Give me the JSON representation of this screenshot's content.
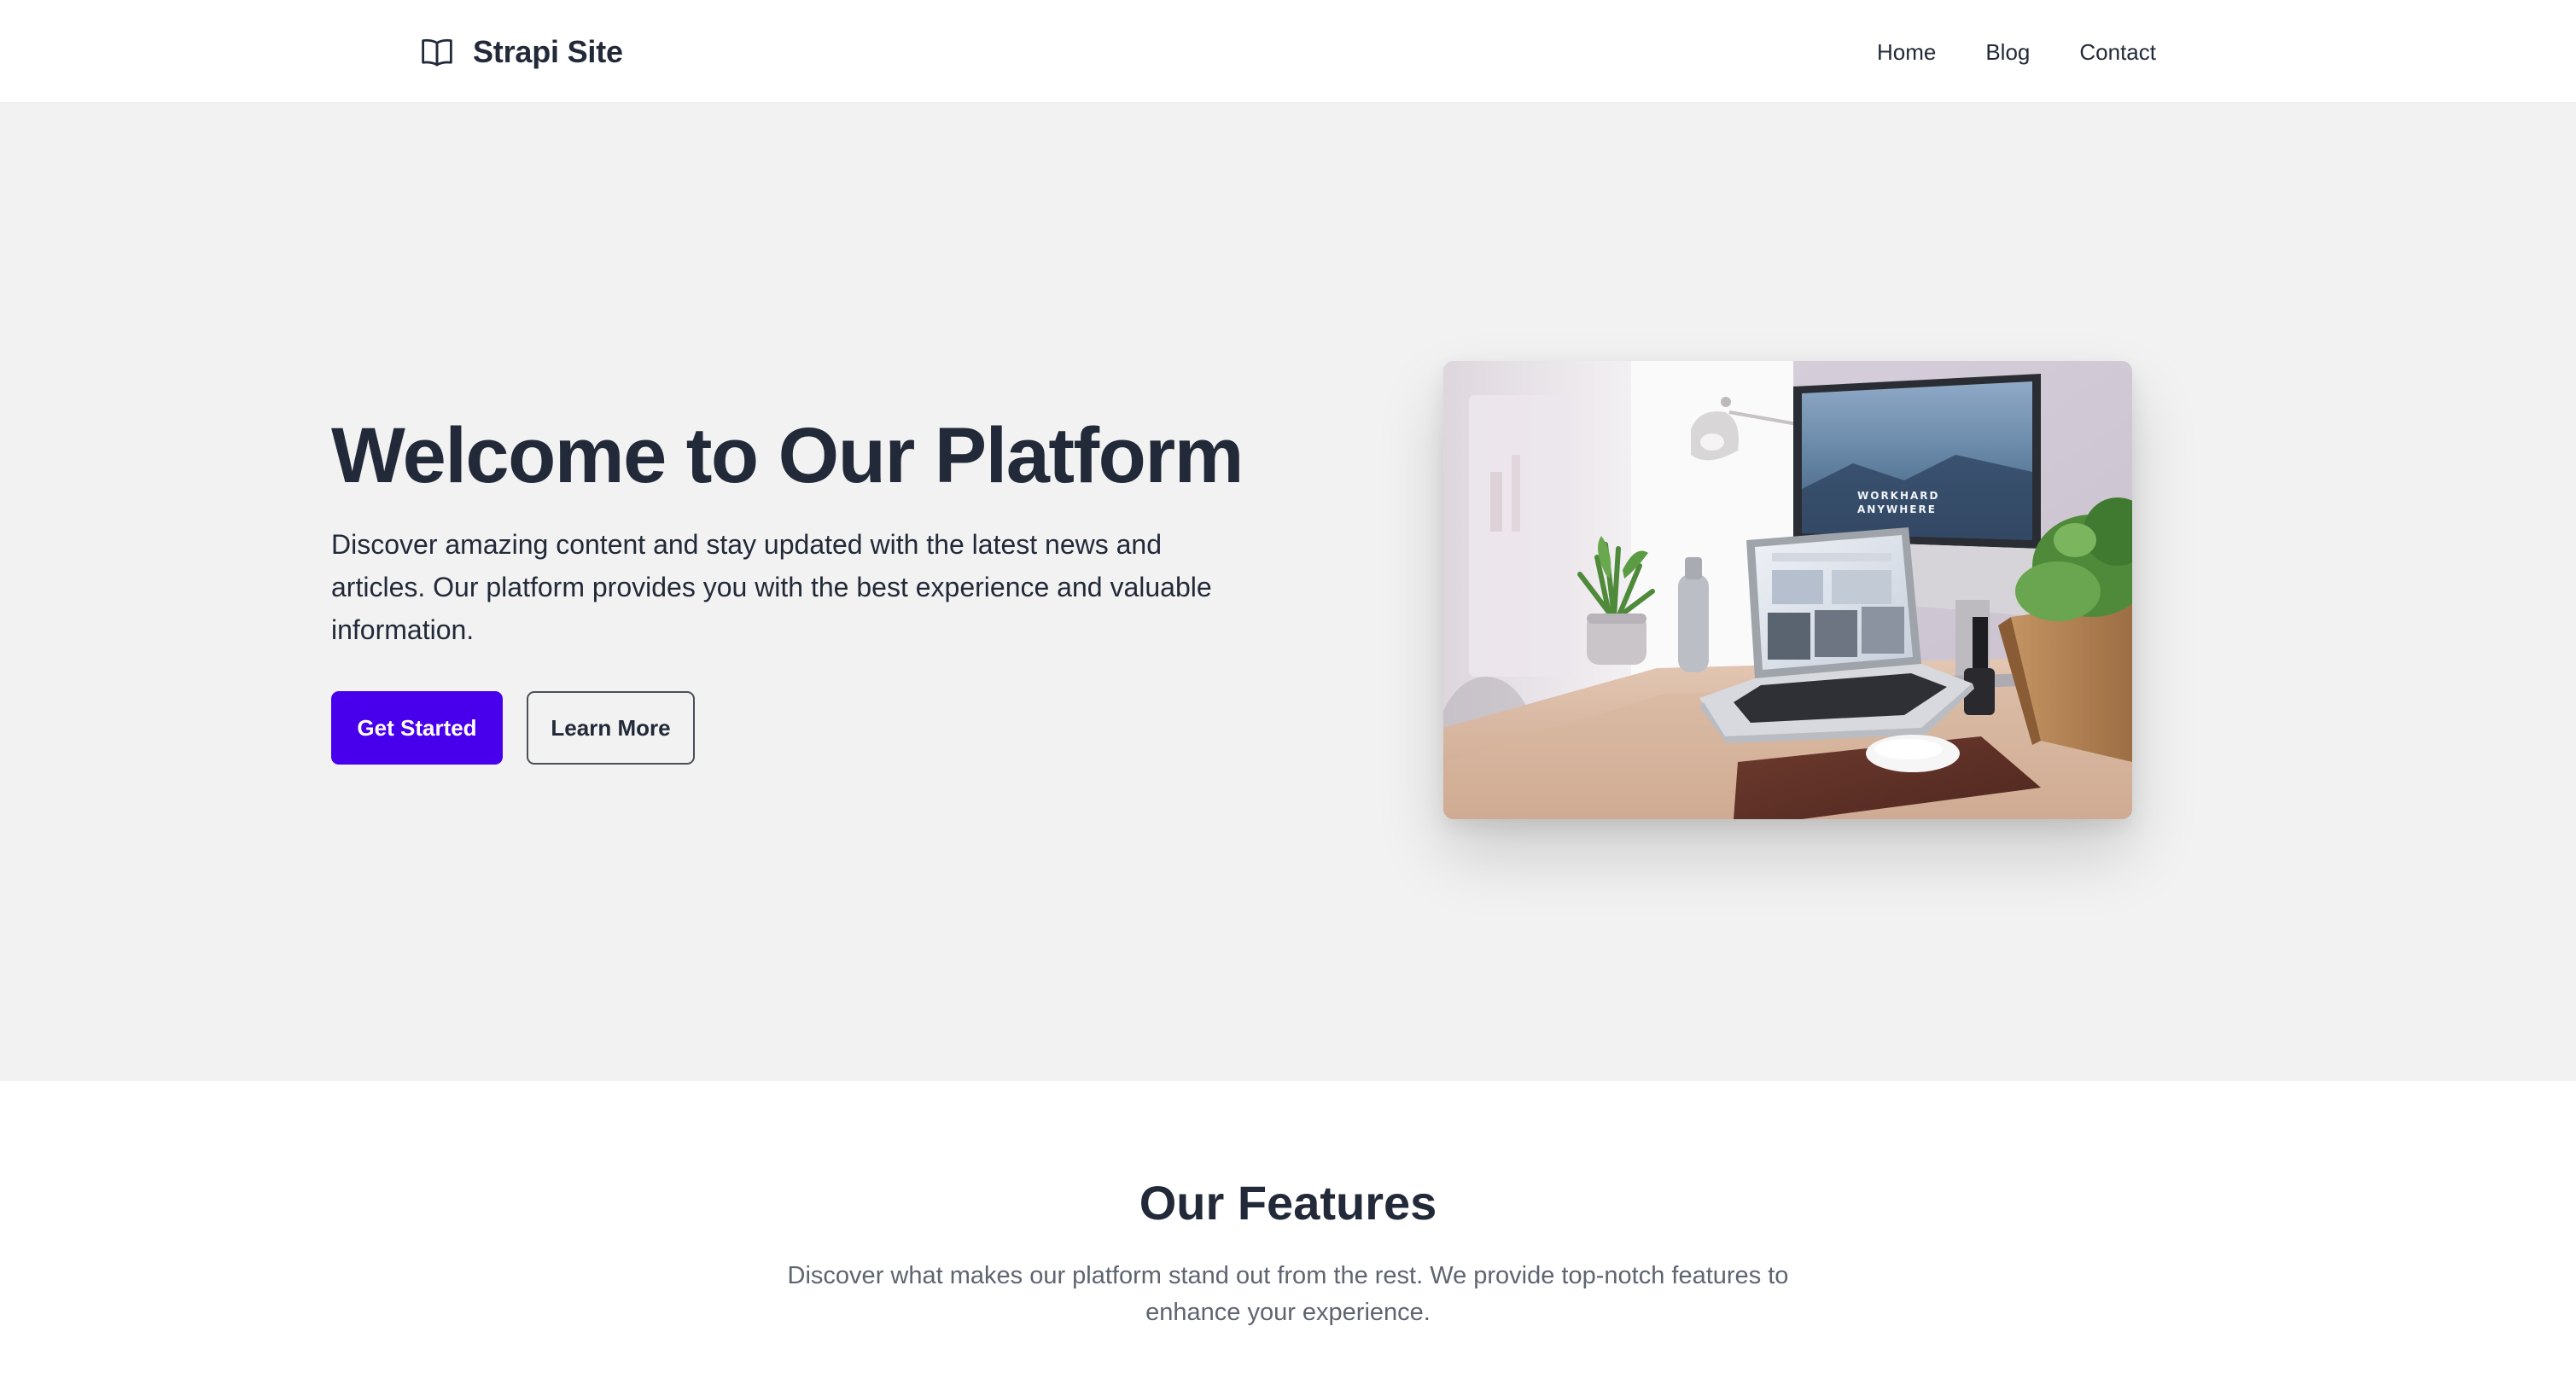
{
  "header": {
    "brand_icon": "book-open-icon",
    "brand_name": "Strapi Site",
    "nav": [
      {
        "label": "Home"
      },
      {
        "label": "Blog"
      },
      {
        "label": "Contact"
      }
    ]
  },
  "hero": {
    "title": "Welcome to Our Platform",
    "description": "Discover amazing content and stay updated with the latest news and articles. Our platform provides you with the best experience and valuable information.",
    "primary_button": "Get Started",
    "secondary_button": "Learn More",
    "image_text": [
      "WORKHARD",
      "ANYWHERE"
    ]
  },
  "features": {
    "title": "Our Features",
    "description": "Discover what makes our platform stand out from the rest. We provide top-notch features to enhance your experience."
  },
  "colors": {
    "primary": "#4800ec",
    "text": "#222938",
    "hero_bg": "#f2f2f2",
    "muted_text": "#5e6470"
  }
}
